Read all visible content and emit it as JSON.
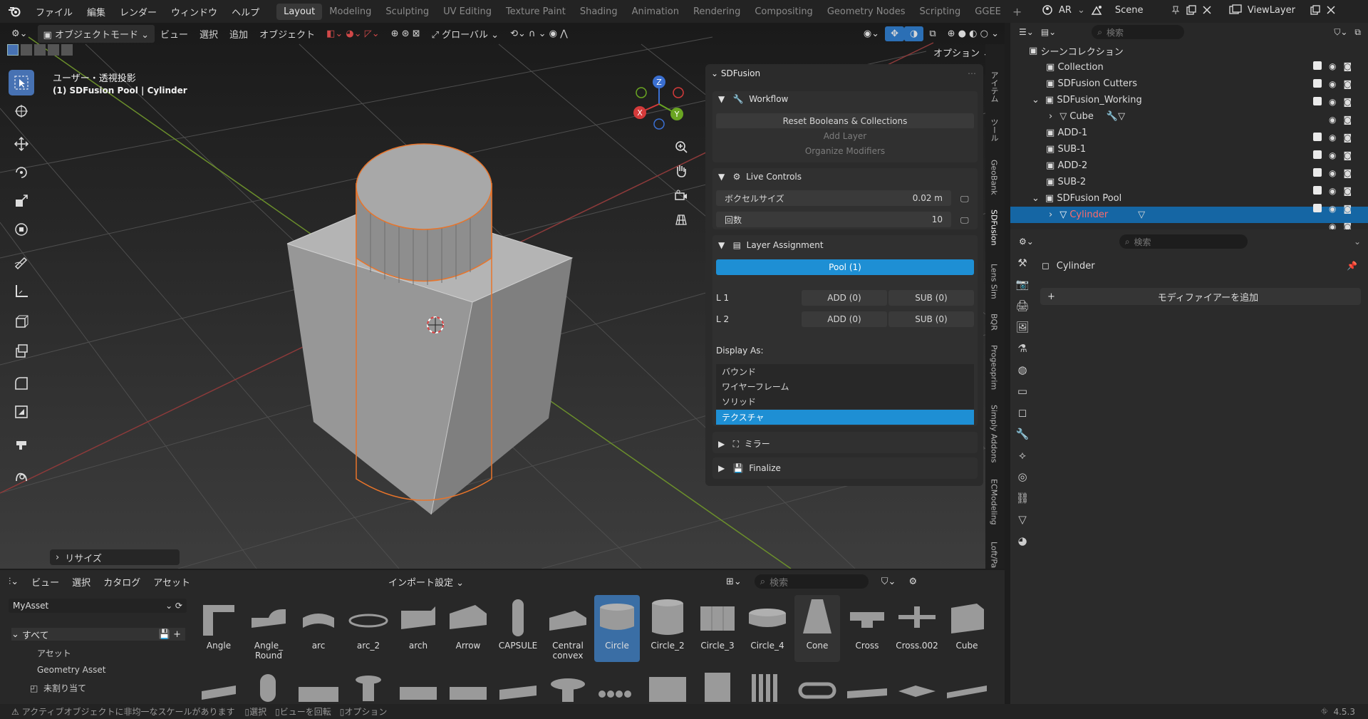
{
  "topbar": {
    "menus": [
      "ファイル",
      "編集",
      "レンダー",
      "ウィンドウ",
      "ヘルプ"
    ],
    "workspaces": [
      "Layout",
      "Modeling",
      "Sculpting",
      "UV Editing",
      "Texture Paint",
      "Shading",
      "Animation",
      "Rendering",
      "Compositing",
      "Geometry Nodes",
      "Scripting",
      "GGEE"
    ],
    "active_workspace": "Layout",
    "ar_label": "AR",
    "scene": "Scene",
    "view_layer": "ViewLayer"
  },
  "viewport_header": {
    "mode": "オブジェクトモード",
    "view": "ビュー",
    "select": "選択",
    "add": "追加",
    "object": "オブジェクト",
    "orientation": "グローバル",
    "options": "オプション"
  },
  "viewport": {
    "view_name": "ユーザー・透視投影",
    "object_info": "(1) SDFusion Pool | Cylinder",
    "operator_panel": "リサイズ",
    "gizmo_axes": [
      "X",
      "Y",
      "Z"
    ]
  },
  "sdfusion": {
    "title": "SDFusion",
    "workflow": {
      "title": "Workflow",
      "reset": "Reset Booleans & Collections",
      "add_layer": "Add Layer",
      "organize": "Organize Modifiers"
    },
    "live_controls": {
      "title": "Live Controls",
      "voxel_label": "ボクセルサイズ",
      "voxel_value": "0.02 m",
      "count_label": "回数",
      "count_value": "10"
    },
    "layer_assignment": {
      "title": "Layer Assignment",
      "pool": "Pool (1)",
      "layers": [
        {
          "name": "L 1",
          "add": "ADD (0)",
          "sub": "SUB (0)"
        },
        {
          "name": "L 2",
          "add": "ADD (0)",
          "sub": "SUB (0)"
        }
      ],
      "display_as": "Display As:",
      "display_options": [
        "バウンド",
        "ワイヤーフレーム",
        "ソリッド",
        "テクスチャ"
      ],
      "display_selected": "テクスチャ"
    },
    "mirror": "ミラー",
    "finalize": "Finalize"
  },
  "sidebar_tabs": [
    "アイテム",
    "ツール",
    "GeoBank",
    "SDFusion",
    "Lens Sim",
    "BQR",
    "Progeoprim",
    "Simply Addons",
    "ECModeling",
    "Loft/Pa"
  ],
  "outliner": {
    "search_placeholder": "検索",
    "root": "シーンコレクション",
    "rows": [
      {
        "label": "Collection"
      },
      {
        "label": "SDFusion Cutters"
      },
      {
        "label": "SDFusion_Working"
      },
      {
        "label": "Cube"
      },
      {
        "label": "ADD-1"
      },
      {
        "label": "SUB-1"
      },
      {
        "label": "ADD-2"
      },
      {
        "label": "SUB-2"
      },
      {
        "label": "SDFusion Pool"
      },
      {
        "label": "Cylinder"
      }
    ]
  },
  "properties": {
    "search_placeholder": "検索",
    "object_name": "Cylinder",
    "add_modifier": "モディファイアーを追加"
  },
  "asset_browser": {
    "menus": [
      "ビュー",
      "選択",
      "カタログ",
      "アセット"
    ],
    "import_settings": "インポート設定",
    "search_placeholder": "検索",
    "library": "MyAsset",
    "catalog_all": "すべて",
    "catalog_items": [
      "アセット",
      "Geometry Asset",
      "未割り当て"
    ],
    "assets": [
      "Angle",
      "Angle_\nRound",
      "arc",
      "arc_2",
      "arch",
      "Arrow",
      "CAPSULE",
      "Central\nconvex",
      "Circle",
      "Circle_2",
      "Circle_3",
      "Circle_4",
      "Cone",
      "Cross",
      "Cross.002",
      "Cube"
    ],
    "selected_asset": "Circle"
  },
  "status": {
    "warning": "アクティブオブジェクトに非均一なスケールがあります",
    "select": "選択",
    "rotate": "ビューを回転",
    "options": "オプション",
    "version": "4.5.3"
  },
  "colors": {
    "accent": "#1e8fd4",
    "selection_orange": "#e8742a",
    "viewport_bg": "#393939",
    "panel_bg": "#2b2b2b"
  }
}
